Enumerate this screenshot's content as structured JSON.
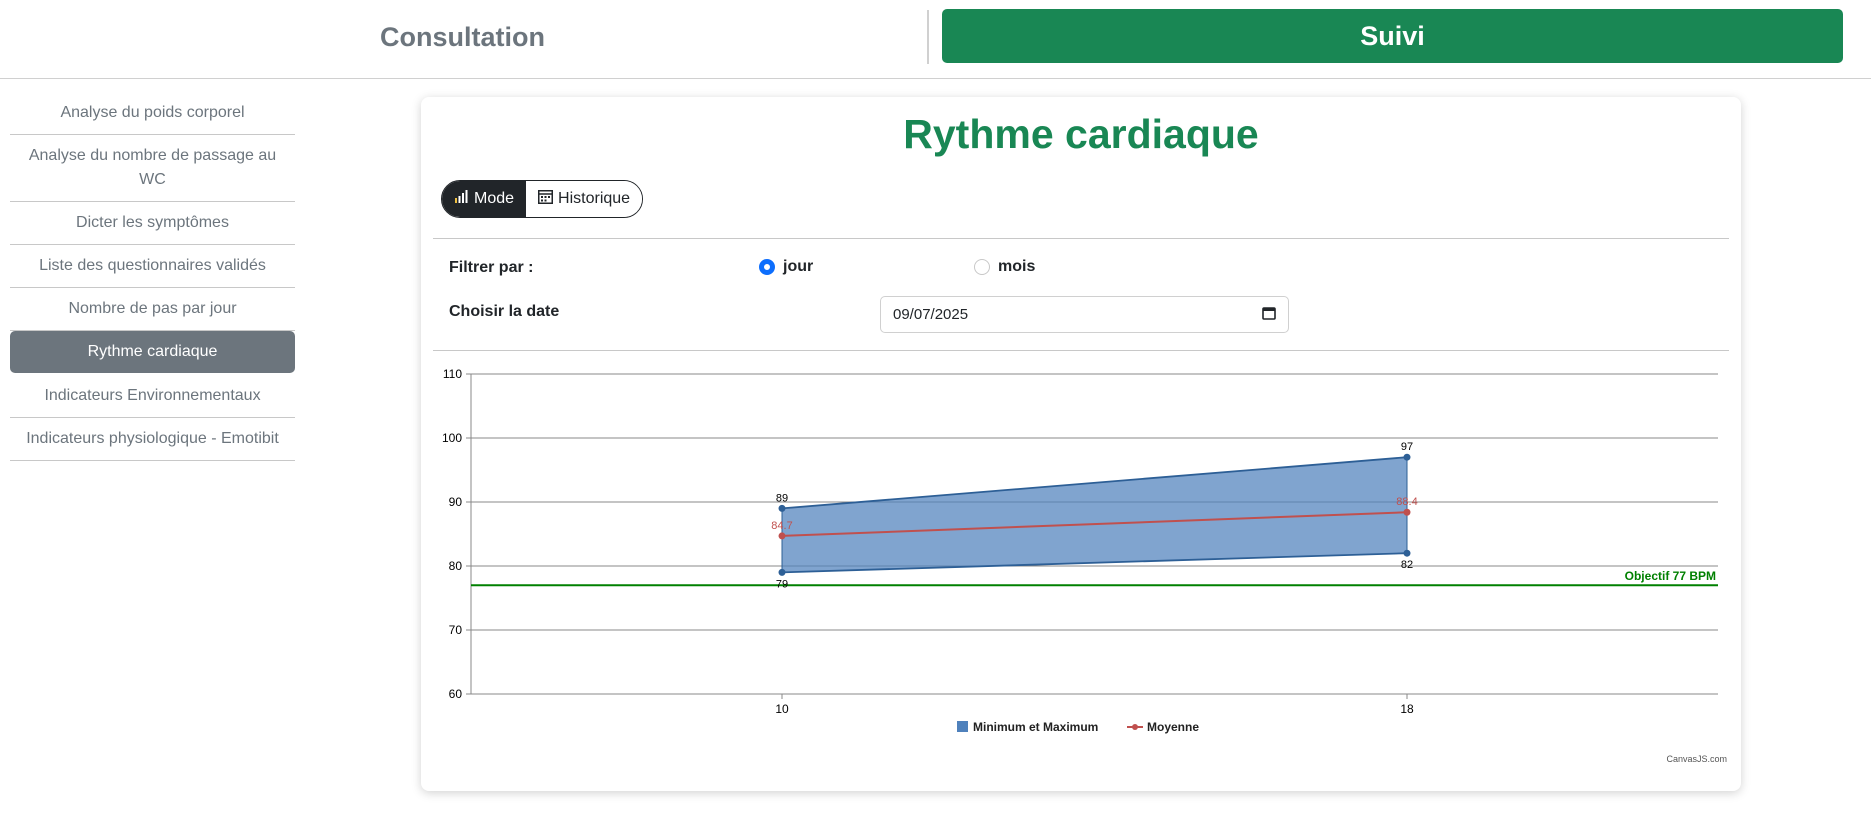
{
  "nav": {
    "consultation_label": "Consultation",
    "suivi_label": "Suivi",
    "active_color": "#198754"
  },
  "sidebar": {
    "items": [
      {
        "label": "Analyse du poids corporel"
      },
      {
        "label": "Analyse du nombre de passage au WC"
      },
      {
        "label": "Dicter les symptômes"
      },
      {
        "label": "Liste des questionnaires validés"
      },
      {
        "label": "Nombre de pas par jour"
      },
      {
        "label": "Rythme cardiaque"
      },
      {
        "label": "Indicateurs Environnementaux"
      },
      {
        "label": "Indicateurs physiologique - Emotibit"
      }
    ],
    "active_index": 5
  },
  "card": {
    "title": "Rythme cardiaque",
    "mode_label": "Mode",
    "historique_label": "Historique",
    "filter_label": "Filtrer par :",
    "radio_jour": "jour",
    "radio_mois": "mois",
    "selected_filter": "jour",
    "date_label": "Choisir la date",
    "date_value": "09/07/2025",
    "credit": "CanvasJS.com",
    "icons": {
      "mode": "bar-chart-icon",
      "historique": "calendar-icon",
      "date": "calendar-icon"
    }
  },
  "chart_data": {
    "type": "area",
    "x": [
      "10",
      "18"
    ],
    "ylim": [
      60,
      110
    ],
    "yticks": [
      60,
      70,
      80,
      90,
      100,
      110
    ],
    "grid": true,
    "legend_position": "bottom",
    "series": [
      {
        "name": "Minimum et Maximum",
        "type": "rangeArea",
        "color": "#4f81bc",
        "low": [
          79,
          82
        ],
        "high": [
          89,
          97
        ]
      },
      {
        "name": "Moyenne",
        "type": "line",
        "color": "#c0504e",
        "values": [
          84.7,
          88.4
        ]
      }
    ],
    "goal": {
      "label": "Objectif 77 BPM",
      "value": 77,
      "color": "#008000"
    }
  }
}
